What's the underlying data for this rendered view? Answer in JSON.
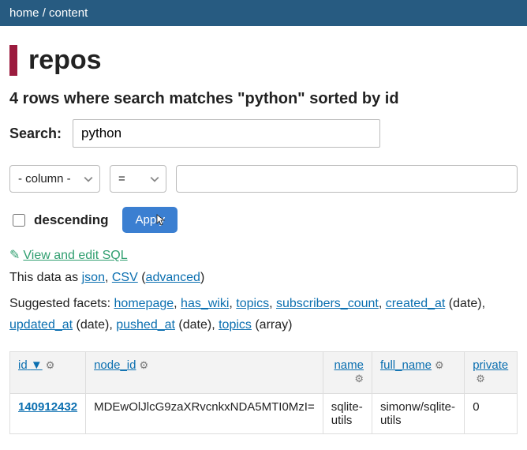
{
  "breadcrumb": {
    "home": "home",
    "content": "content",
    "sep": "/"
  },
  "title": "repos",
  "subtitle": "4 rows where search matches \"python\" sorted by id",
  "search": {
    "label": "Search:",
    "value": "python"
  },
  "filter": {
    "column_placeholder": "- column -",
    "op_placeholder": "=",
    "value": ""
  },
  "descending_label": "descending",
  "apply_label": "Apply",
  "view_sql": "View and edit SQL",
  "data_as_prefix": "This data as ",
  "formats": {
    "json": "json",
    "csv": "CSV",
    "advanced": "advanced"
  },
  "facets_prefix": "Suggested facets: ",
  "facets": {
    "homepage": "homepage",
    "has_wiki": "has_wiki",
    "topics": "topics",
    "subscribers_count": "subscribers_count",
    "created_at": "created_at",
    "updated_at": "updated_at",
    "pushed_at": "pushed_at",
    "topics_array": "topics",
    "date_suffix": " (date)",
    "array_suffix": " (array)",
    "sep": ", "
  },
  "columns": {
    "id": "id",
    "sort_desc_symbol": "▼",
    "node_id": "node_id",
    "name": "name",
    "full_name": "full_name",
    "private": "private"
  },
  "row": {
    "id": "140912432",
    "node_id": "MDEwOlJlcG9zaXRvcnkxNDA5MTI0MzI=",
    "name": "sqlite-utils",
    "full_name": "simonw/sqlite-utils",
    "private": "0"
  }
}
